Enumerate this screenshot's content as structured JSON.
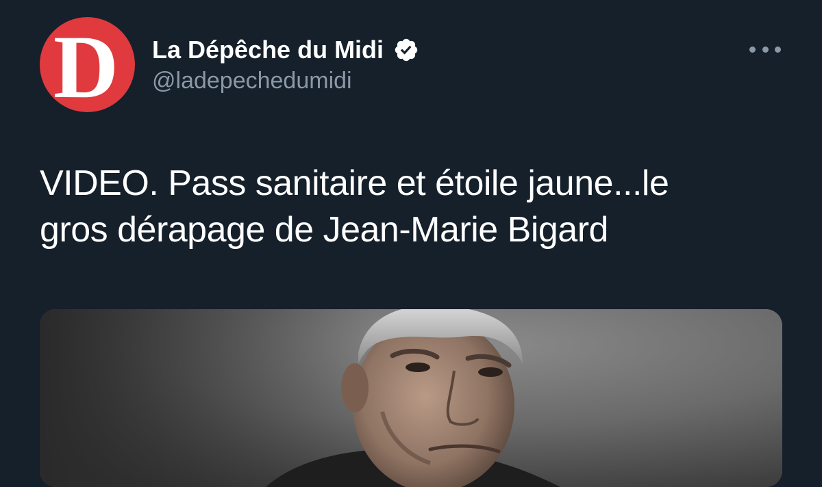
{
  "account": {
    "display_name": "La Dépêche du Midi",
    "handle": "@ladepechedumidi",
    "avatar_letter": "D",
    "avatar_color": "#e03a3e",
    "verified_icon": "verified-badge-icon"
  },
  "menu": {
    "icon": "more-options-icon"
  },
  "tweet": {
    "text_line1": "VIDEO. Pass sanitaire et étoile jaune...le",
    "text_line2": "gros dérapage de Jean-Marie Bigard"
  },
  "colors": {
    "background": "#15202b",
    "secondary_text": "#8b98a5",
    "primary_text": "#ffffff"
  }
}
